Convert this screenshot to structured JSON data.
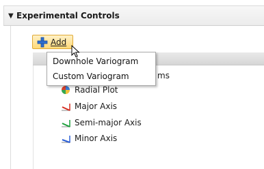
{
  "section": {
    "arrow": "▼",
    "title": "Experimental Controls"
  },
  "add_button": {
    "label": "Add",
    "icon": "plus-icon",
    "accent": "#ffd978"
  },
  "dropdown": {
    "items": [
      {
        "label": "Downhole Variogram"
      },
      {
        "label": "Custom Variogram"
      }
    ]
  },
  "tree": {
    "partial_label": "ms",
    "items": [
      {
        "label": "Radial Plot",
        "icon": "radial-plot-icon"
      },
      {
        "label": "Major Axis",
        "icon": "major-axis-icon",
        "color": "#d62d20"
      },
      {
        "label": "Semi-major Axis",
        "icon": "semi-major-axis-icon",
        "color": "#1a9f3a"
      },
      {
        "label": "Minor Axis",
        "icon": "minor-axis-icon",
        "color": "#2c5fd6"
      }
    ]
  }
}
